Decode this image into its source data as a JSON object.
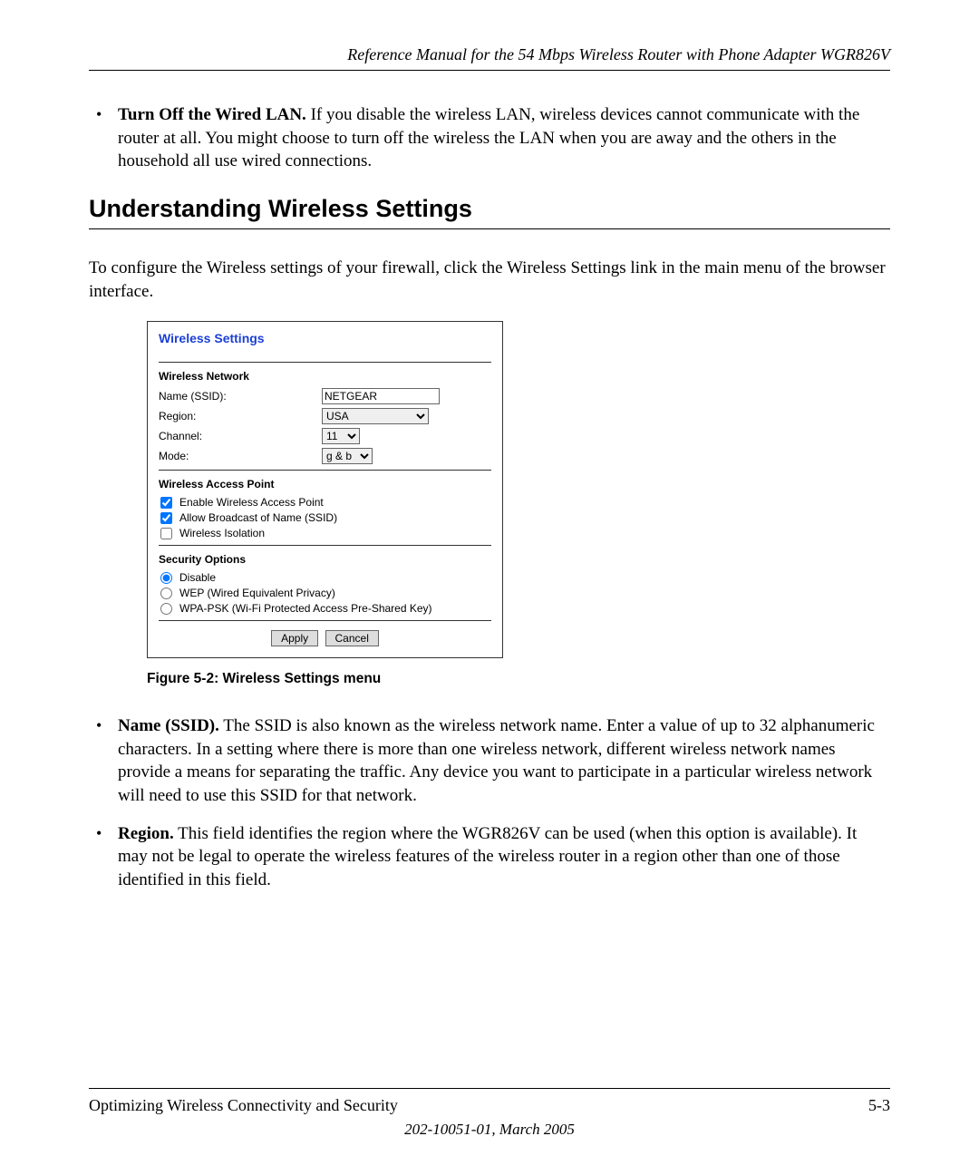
{
  "header": {
    "title": "Reference Manual for the 54 Mbps Wireless Router with Phone Adapter WGR826V"
  },
  "intro_bullet": {
    "bold": "Turn Off the Wired LAN.",
    "text": " If you disable the wireless LAN, wireless devices cannot communicate with the router at all. You might choose to turn off the wireless the LAN when you are away and the others in the household all use wired connections."
  },
  "section_heading": "Understanding Wireless Settings",
  "section_paragraph": "To configure the Wireless settings of your firewall, click the Wireless Settings link in the main menu of the browser interface.",
  "screenshot": {
    "title": "Wireless Settings",
    "wireless_network": {
      "heading": "Wireless Network",
      "name_label": "Name (SSID):",
      "name_value": "NETGEAR",
      "region_label": "Region:",
      "region_value": "USA",
      "channel_label": "Channel:",
      "channel_value": "11",
      "mode_label": "Mode:",
      "mode_value": "g & b"
    },
    "access_point": {
      "heading": "Wireless Access Point",
      "enable_label": "Enable Wireless Access Point",
      "broadcast_label": "Allow Broadcast of Name (SSID)",
      "isolation_label": "Wireless Isolation"
    },
    "security": {
      "heading": "Security Options",
      "disable_label": "Disable",
      "wep_label": "WEP (Wired Equivalent Privacy)",
      "wpa_label": "WPA-PSK (Wi-Fi Protected Access Pre-Shared Key)"
    },
    "buttons": {
      "apply": "Apply",
      "cancel": "Cancel"
    }
  },
  "figure_caption": "Figure 5-2:  Wireless Settings menu",
  "bullets": [
    {
      "bold": "Name (SSID).",
      "text": " The SSID is also known as the wireless network name. Enter a value of up to 32 alphanumeric characters. In a setting where there is more than one wireless network, different wireless network names provide a means for separating the traffic. Any device you want to participate in a particular wireless network will need to use this SSID for that network."
    },
    {
      "bold": "Region.",
      "text": " This field identifies the region where the WGR826V can be used (when this option is available). It may not be legal to operate the wireless features of the wireless router in a region other than one of those identified in this field."
    }
  ],
  "footer": {
    "left": "Optimizing Wireless Connectivity and Security",
    "right": "5-3",
    "docid": "202-10051-01, March 2005"
  }
}
